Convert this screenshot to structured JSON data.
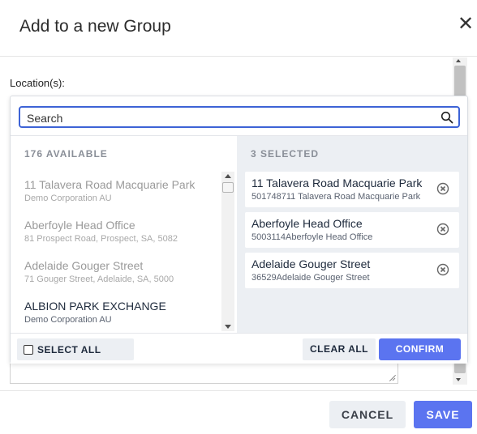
{
  "dialog": {
    "title": "Add to a new Group",
    "close_glyph": "✕"
  },
  "form": {
    "location_label": "Location(s):"
  },
  "picker": {
    "search": {
      "placeholder": "Search",
      "value": ""
    },
    "available": {
      "header": "176 AVAILABLE",
      "items": [
        {
          "name": "11 Talavera Road Macquarie Park",
          "sub": "Demo Corporation AU",
          "active": false
        },
        {
          "name": "Aberfoyle Head Office",
          "sub": "81 Prospect Road, Prospect, SA, 5082",
          "active": false
        },
        {
          "name": "Adelaide Gouger Street",
          "sub": "71 Gouger Street, Adelaide, SA, 5000",
          "active": false
        },
        {
          "name": "ALBION PARK EXCHANGE",
          "sub": "Demo Corporation AU",
          "active": true
        }
      ]
    },
    "selected": {
      "header": "3 SELECTED",
      "items": [
        {
          "name": "11 Talavera Road Macquarie Park",
          "sub": "501748711 Talavera Road Macquarie Park"
        },
        {
          "name": "Aberfoyle Head Office",
          "sub": "5003114Aberfoyle Head Office"
        },
        {
          "name": "Adelaide Gouger Street",
          "sub": "36529Adelaide Gouger Street"
        }
      ]
    },
    "footer": {
      "select_all": "SELECT ALL",
      "clear_all": "CLEAR ALL",
      "confirm": "CONFIRM"
    }
  },
  "actions": {
    "cancel": "CANCEL",
    "save": "SAVE"
  },
  "colors": {
    "accent": "#5b74f0",
    "search_border": "#3d63d6",
    "selected_bg": "#eceff3"
  }
}
